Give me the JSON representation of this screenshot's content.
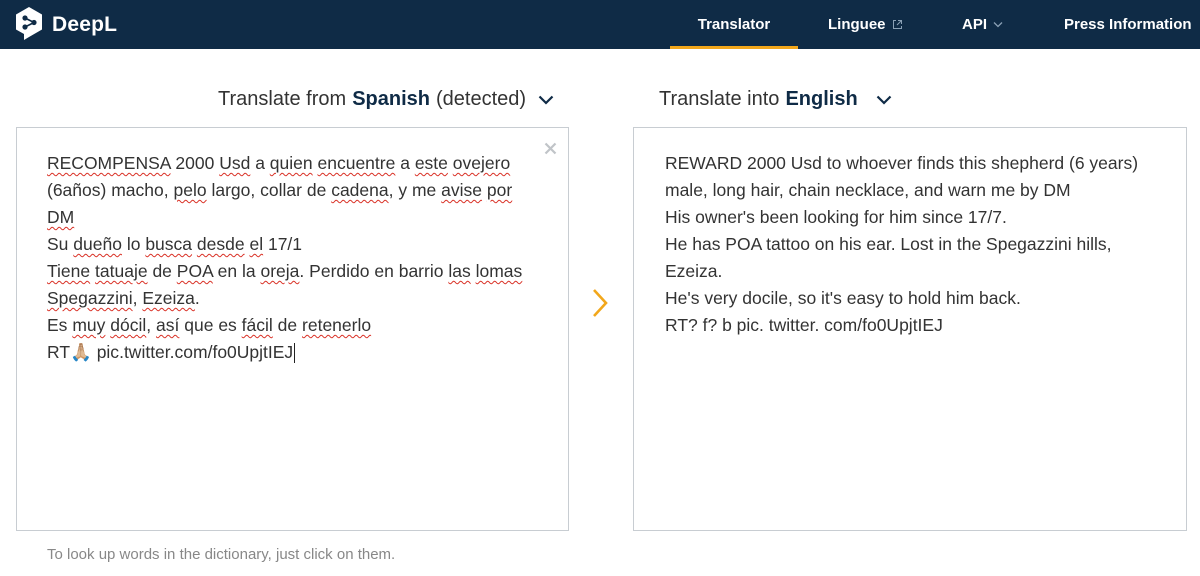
{
  "header": {
    "logo_text": "DeepL",
    "nav": [
      {
        "label": "Translator"
      },
      {
        "label": "Linguee"
      },
      {
        "label": "API"
      },
      {
        "label": "Press Information"
      }
    ]
  },
  "source": {
    "prefix": "Translate from",
    "language": "Spanish",
    "suffix": "(detected)",
    "lines": [
      "RECOMPENSA 2000 Usd a quien encuentre a este ovejero",
      "(6años) macho, pelo largo, collar de cadena, y me avise por",
      "DM",
      "Su dueño lo busca desde el 17/1",
      "Tiene tatuaje de POA en la oreja. Perdido en barrio las lomas",
      "Spegazzini, Ezeiza.",
      "Es muy dócil, así que es fácil de retenerlo",
      "RT🙏🏼 pic.twitter.com/fo0UpjtIEJ"
    ]
  },
  "target": {
    "prefix": "Translate into",
    "language": "English",
    "lines": [
      "REWARD 2000 Usd to whoever finds this shepherd (6 years)",
      "male, long hair, chain necklace, and warn me by DM",
      "His owner's been looking for him since 17/7.",
      "He has POA tattoo on his ear. Lost in the Spegazzini hills,",
      "Ezeiza.",
      "He's very docile, so it's easy to hold him back.",
      "RT? f? b pic. twitter. com/fo0UpjtIEJ"
    ]
  },
  "hint": "To look up words in the dictionary, just click on them.",
  "colors": {
    "header_bg": "#0f2b46",
    "accent": "#f2a71b",
    "language_text": "#0f2b46",
    "spellcheck": "#d93025"
  },
  "icons": [
    "deepl-logo-icon",
    "external-link-icon",
    "chevron-down-icon",
    "close-icon",
    "chevron-right-icon"
  ]
}
